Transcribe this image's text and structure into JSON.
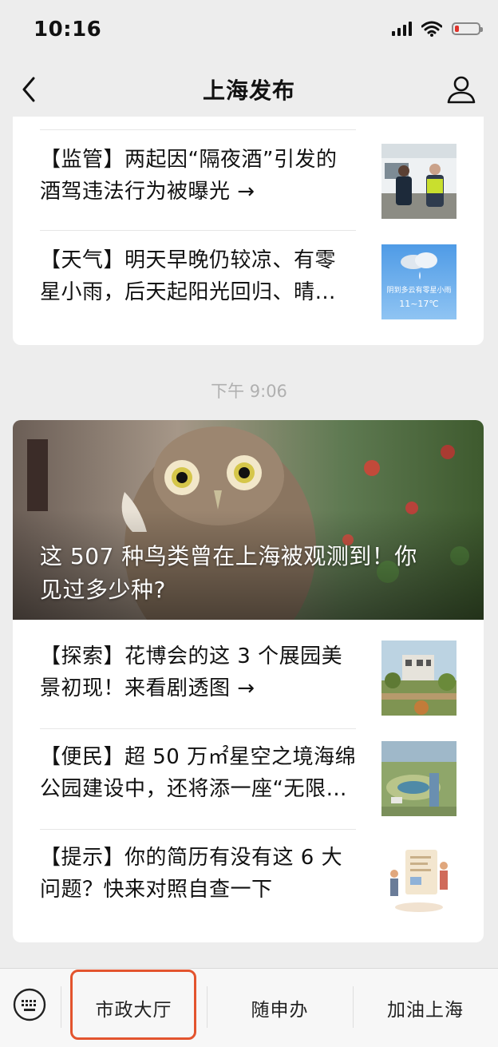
{
  "status_bar": {
    "time": "10:16",
    "icons": [
      "signal-icon",
      "wifi-icon",
      "battery-low-icon"
    ],
    "battery_color": "#e0332b"
  },
  "nav": {
    "title": "上海发布",
    "back_icon": "chevron-left-icon",
    "profile_icon": "person-icon"
  },
  "feed_top": {
    "items": [
      {
        "lines": [
          "【监管】两起因“隔夜酒”引发的",
          "酒驾违法行为被曝光 →"
        ],
        "thumb": "police-photo"
      },
      {
        "lines": [
          "【天气】明天早晚仍较凉、有零",
          "星小雨，后天起阳光回归、晴…"
        ],
        "thumb": "weather-card",
        "thumb_texts": [
          "阴到多云有零星小雨",
          "11~17℃"
        ]
      }
    ]
  },
  "time_label": "下午 9:06",
  "feed_main": {
    "hero_title_lines": [
      "这 507 种鸟类曾在上海被观测到！你",
      "见过多少种?"
    ],
    "items": [
      {
        "lines": [
          "【探索】花博会的这 3 个展园美",
          "景初现！来看剧透图 →"
        ],
        "thumb": "garden-photo"
      },
      {
        "lines": [
          "【便民】超 50 万㎡星空之境海绵",
          "公园建设中，还将添一座“无限…"
        ],
        "thumb": "park-aerial-photo"
      },
      {
        "lines": [
          "【提示】你的简历有没有这 6 大",
          "问题？快来对照自查一下"
        ],
        "thumb": "resume-illustration"
      }
    ]
  },
  "bottom_menu": {
    "keyboard_icon": "keyboard-icon",
    "items": [
      "市政大厅",
      "随申办",
      "加油上海"
    ],
    "highlight_color": "#e3542e"
  }
}
